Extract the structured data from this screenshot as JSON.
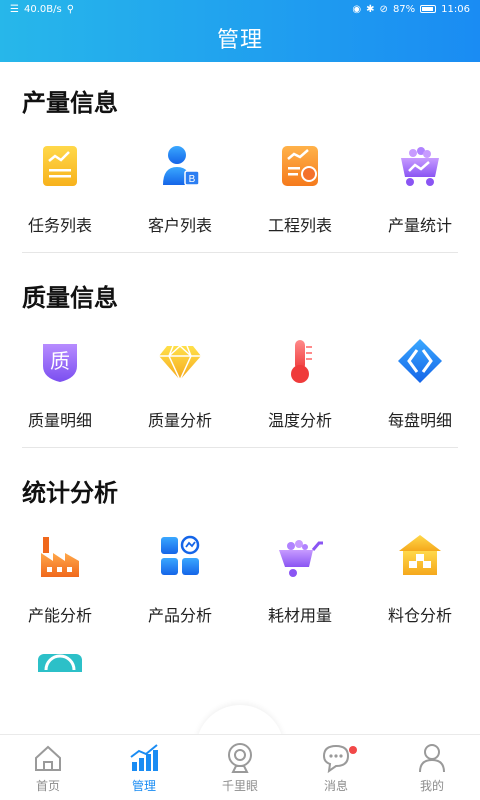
{
  "status_bar": {
    "speed": "40.0B/s",
    "battery": "87%",
    "time": "11:06"
  },
  "header": {
    "title": "管理"
  },
  "sections": [
    {
      "title": "产量信息",
      "items": [
        {
          "label": "任务列表",
          "icon": "task-list-icon"
        },
        {
          "label": "客户列表",
          "icon": "customer-list-icon"
        },
        {
          "label": "工程列表",
          "icon": "project-list-icon"
        },
        {
          "label": "产量统计",
          "icon": "output-stats-icon"
        }
      ]
    },
    {
      "title": "质量信息",
      "items": [
        {
          "label": "质量明细",
          "icon": "quality-detail-icon"
        },
        {
          "label": "质量分析",
          "icon": "diamond-icon"
        },
        {
          "label": "温度分析",
          "icon": "thermometer-icon"
        },
        {
          "label": "每盘明细",
          "icon": "batch-detail-icon"
        }
      ]
    },
    {
      "title": "统计分析",
      "items": [
        {
          "label": "产能分析",
          "icon": "factory-icon"
        },
        {
          "label": "产品分析",
          "icon": "product-grid-icon"
        },
        {
          "label": "耗材用量",
          "icon": "cart-icon"
        },
        {
          "label": "料仓分析",
          "icon": "warehouse-icon"
        }
      ]
    }
  ],
  "partial_icon": "gauge-icon",
  "bottom_nav": [
    {
      "label": "首页",
      "icon": "home-icon",
      "active": false
    },
    {
      "label": "管理",
      "icon": "chart-icon",
      "active": true
    },
    {
      "label": "千里眼",
      "icon": "camera-icon",
      "active": false
    },
    {
      "label": "消息",
      "icon": "message-icon",
      "active": false
    },
    {
      "label": "我的",
      "icon": "person-icon",
      "active": false
    }
  ],
  "colors": {
    "header_start": "#27b7ea",
    "header_end": "#1a8cf3",
    "active_nav": "#1a8cf3",
    "badge": "#f24848"
  }
}
